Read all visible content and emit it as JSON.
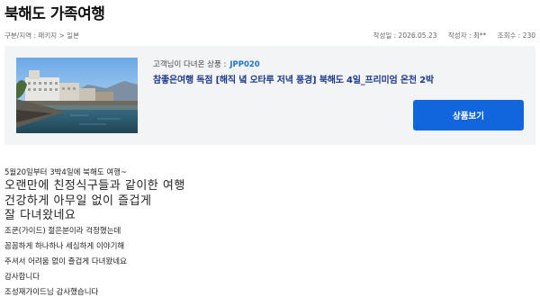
{
  "page": {
    "title": "북해도 가족여행"
  },
  "meta": {
    "breadcrumb": "구분/지역 : 패키지 > 일본",
    "date": "작성일 : 2026.05.23",
    "author": "작성자 : 최**",
    "views": "조회수 : 230"
  },
  "product": {
    "prefix": "고객님이 다녀온 상품 :",
    "code": "JPP020",
    "name": "참좋은여행 독점 [해직 녘 오타루 저녁 풍경] 북해도 4일_프리미엄 온천 2박",
    "button_label": "상품보기",
    "accent_color": "#1166dd"
  },
  "review": {
    "lines": [
      "5월20일부터  3박4일에 북해도 여행~",
      "오랜만에  친정식구들과  같이한 여행",
      "건강하게  아무일 없이  즐겁게",
      "잘  다녀왔네요",
      "조쿤(가이드)  젊은분이라 걱정했는데",
      "꼼꼼하게 하나하나 세심하게  이야기해",
      "주셔서  어려움 없이 즐겁게 다녀왔네요",
      "감사합니다",
      "조성재가이드님  감사했습니다"
    ]
  }
}
